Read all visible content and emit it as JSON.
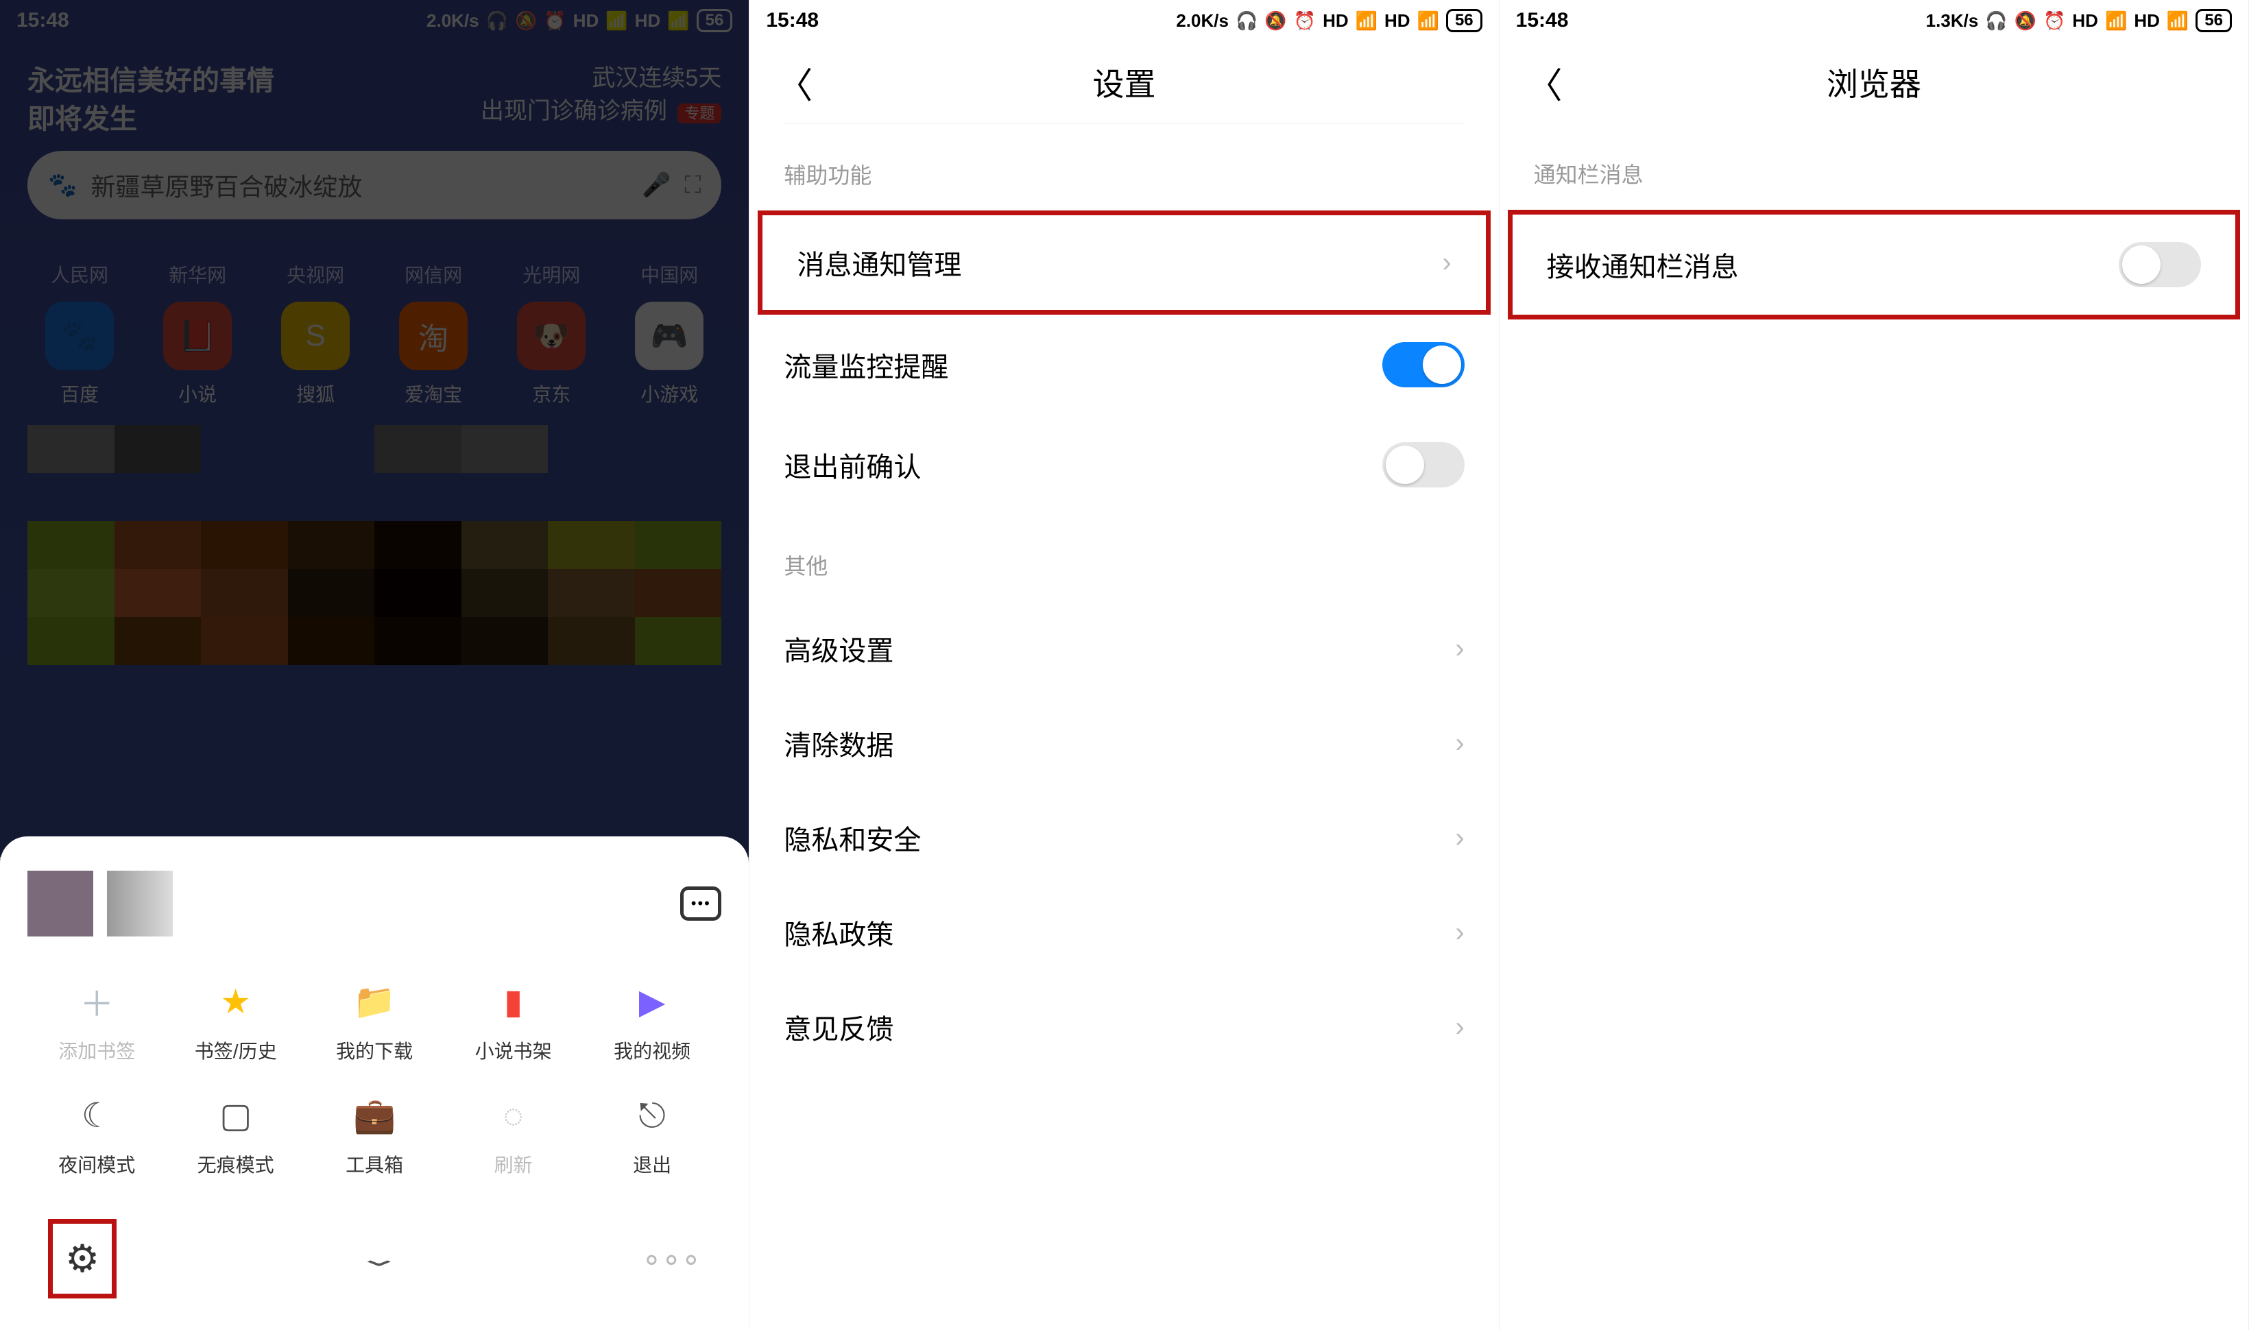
{
  "status": {
    "time": "15:48",
    "speed_a": "2.0K/s",
    "speed_c": "1.3K/s",
    "battery": "56",
    "hd": "HD",
    "net": "4G"
  },
  "s1": {
    "banner_l1": "永远相信美好的事情",
    "banner_l2": "即将发生",
    "banner_r1": "武汉连续5天",
    "banner_r2": "出现门诊确诊病例",
    "banner_tag": "专题",
    "search_hint": "新疆草原野百合破冰绽放",
    "sites": [
      "人民网",
      "新华网",
      "央视网",
      "网信网",
      "光明网",
      "中国网"
    ],
    "apps": [
      {
        "label": "百度",
        "color": "bg-blue",
        "glyph": "🐾"
      },
      {
        "label": "小说",
        "color": "bg-red",
        "glyph": "📕"
      },
      {
        "label": "搜狐",
        "color": "bg-yellow",
        "glyph": "S"
      },
      {
        "label": "爱淘宝",
        "color": "bg-orange",
        "glyph": "淘"
      },
      {
        "label": "京东",
        "color": "bg-red",
        "glyph": "🐶"
      },
      {
        "label": "小游戏",
        "color": "bg-ltyellow",
        "glyph": "🎮"
      }
    ],
    "sheet_items_row1": [
      {
        "label": "添加书签",
        "color": "#b8c0cc",
        "glyph": "＋",
        "dim": true
      },
      {
        "label": "书签/历史",
        "color": "#ffc107",
        "glyph": "★"
      },
      {
        "label": "我的下载",
        "color": "#2196f3",
        "glyph": "📁"
      },
      {
        "label": "小说书架",
        "color": "#f44336",
        "glyph": "▮"
      },
      {
        "label": "我的视频",
        "color": "#7b61ff",
        "glyph": "▶"
      }
    ],
    "sheet_items_row2": [
      {
        "label": "夜间模式",
        "glyph": "☾"
      },
      {
        "label": "无痕模式",
        "glyph": "▢"
      },
      {
        "label": "工具箱",
        "glyph": "💼"
      },
      {
        "label": "刷新",
        "glyph": "◌",
        "dim": true
      },
      {
        "label": "退出",
        "glyph": "⎋"
      }
    ]
  },
  "s2": {
    "title": "设置",
    "grp1": "辅助功能",
    "r1": "消息通知管理",
    "r2": "流量监控提醒",
    "r3": "退出前确认",
    "grp2": "其他",
    "r4": "高级设置",
    "r5": "清除数据",
    "r6": "隐私和安全",
    "r7": "隐私政策",
    "r8": "意见反馈"
  },
  "s3": {
    "title": "浏览器",
    "grp": "通知栏消息",
    "row": "接收通知栏消息"
  }
}
